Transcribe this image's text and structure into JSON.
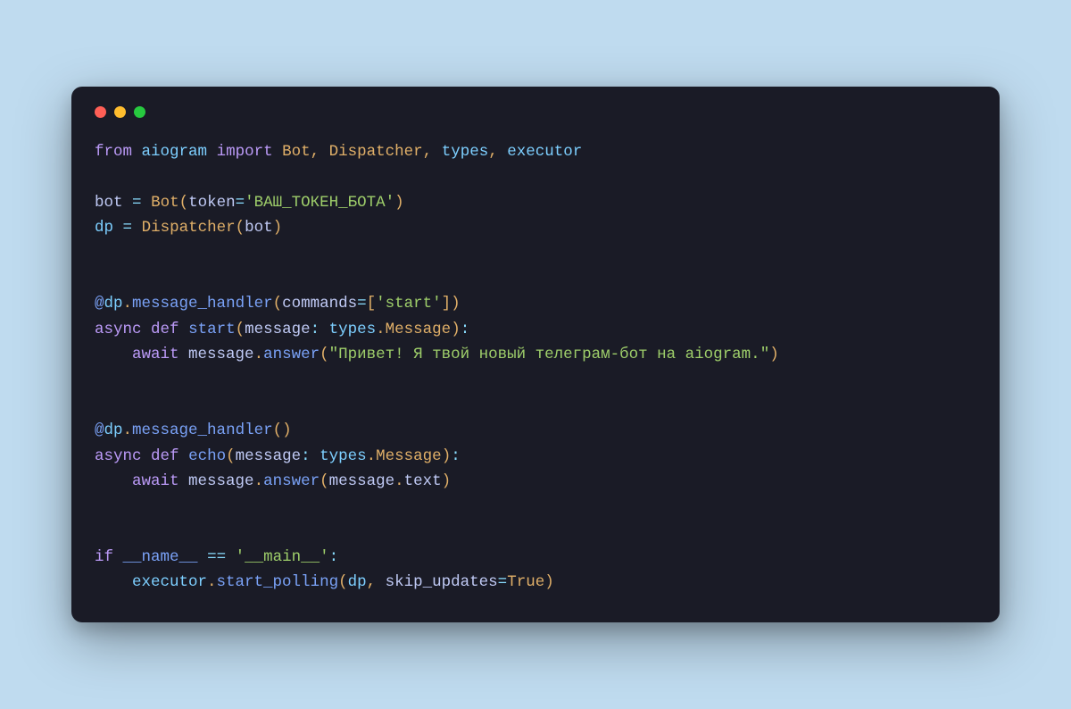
{
  "window": {
    "controls": [
      "close",
      "minimize",
      "zoom"
    ]
  },
  "tokens": [
    [
      [
        "kw",
        "from"
      ],
      [
        "",
        ""
      ],
      [
        "pkg",
        "aiogram"
      ],
      [
        "",
        ""
      ],
      [
        "kw",
        "import"
      ],
      [
        "",
        ""
      ],
      [
        "cls",
        "Bot"
      ],
      [
        "pun",
        ","
      ],
      [
        "",
        ""
      ],
      [
        "cls",
        "Dispatcher"
      ],
      [
        "pun",
        ","
      ],
      [
        "",
        ""
      ],
      [
        "pkg",
        "types"
      ],
      [
        "pun",
        ","
      ],
      [
        "",
        ""
      ],
      [
        "pkg",
        "executor"
      ]
    ],
    [],
    [
      [
        "var",
        "bot"
      ],
      [
        "",
        ""
      ],
      [
        "op",
        "="
      ],
      [
        "",
        ""
      ],
      [
        "cls",
        "Bot"
      ],
      [
        "pun",
        "("
      ],
      [
        "var",
        "token"
      ],
      [
        "op",
        "="
      ],
      [
        "str",
        "'ВАШ_ТОКЕН_БОТА'"
      ],
      [
        "pun",
        ")"
      ]
    ],
    [
      [
        "pkg",
        "dp"
      ],
      [
        "",
        ""
      ],
      [
        "op",
        "="
      ],
      [
        "",
        ""
      ],
      [
        "cls",
        "Dispatcher"
      ],
      [
        "pun",
        "("
      ],
      [
        "var",
        "bot"
      ],
      [
        "pun",
        ")"
      ]
    ],
    [],
    [],
    [
      [
        "at",
        "@"
      ],
      [
        "pkg",
        "dp"
      ],
      [
        "pun",
        "."
      ],
      [
        "fn",
        "message_handler"
      ],
      [
        "pun",
        "("
      ],
      [
        "var",
        "commands"
      ],
      [
        "op",
        "="
      ],
      [
        "pun",
        "["
      ],
      [
        "str",
        "'start'"
      ],
      [
        "pun",
        "]"
      ],
      [
        "pun",
        ")"
      ]
    ],
    [
      [
        "kw",
        "async"
      ],
      [
        "",
        ""
      ],
      [
        "kw",
        "def"
      ],
      [
        "",
        ""
      ],
      [
        "fn",
        "start"
      ],
      [
        "pun",
        "("
      ],
      [
        "var",
        "message"
      ],
      [
        "op",
        ":"
      ],
      [
        "",
        ""
      ],
      [
        "pkg",
        "types"
      ],
      [
        "pun",
        "."
      ],
      [
        "cls",
        "Message"
      ],
      [
        "pun",
        ")"
      ],
      [
        "op",
        ":"
      ]
    ],
    [
      [
        "",
        "    "
      ],
      [
        "kw",
        "await"
      ],
      [
        "",
        ""
      ],
      [
        "var",
        "message"
      ],
      [
        "pun",
        "."
      ],
      [
        "fn",
        "answer"
      ],
      [
        "pun",
        "("
      ],
      [
        "str",
        "\"Привет! Я твой новый телеграм-бот на aiogram.\""
      ],
      [
        "pun",
        ")"
      ]
    ],
    [],
    [],
    [
      [
        "at",
        "@"
      ],
      [
        "pkg",
        "dp"
      ],
      [
        "pun",
        "."
      ],
      [
        "fn",
        "message_handler"
      ],
      [
        "pun",
        "("
      ],
      [
        "pun",
        ")"
      ]
    ],
    [
      [
        "kw",
        "async"
      ],
      [
        "",
        ""
      ],
      [
        "kw",
        "def"
      ],
      [
        "",
        ""
      ],
      [
        "fn",
        "echo"
      ],
      [
        "pun",
        "("
      ],
      [
        "var",
        "message"
      ],
      [
        "op",
        ":"
      ],
      [
        "",
        ""
      ],
      [
        "pkg",
        "types"
      ],
      [
        "pun",
        "."
      ],
      [
        "cls",
        "Message"
      ],
      [
        "pun",
        ")"
      ],
      [
        "op",
        ":"
      ]
    ],
    [
      [
        "",
        "    "
      ],
      [
        "kw",
        "await"
      ],
      [
        "",
        ""
      ],
      [
        "var",
        "message"
      ],
      [
        "pun",
        "."
      ],
      [
        "fn",
        "answer"
      ],
      [
        "pun",
        "("
      ],
      [
        "var",
        "message"
      ],
      [
        "pun",
        "."
      ],
      [
        "var",
        "text"
      ],
      [
        "pun",
        ")"
      ]
    ],
    [],
    [],
    [
      [
        "kw",
        "if"
      ],
      [
        "",
        ""
      ],
      [
        "fn",
        "__name__"
      ],
      [
        "",
        ""
      ],
      [
        "op",
        "=="
      ],
      [
        "",
        ""
      ],
      [
        "str",
        "'__main__'"
      ],
      [
        "op",
        ":"
      ]
    ],
    [
      [
        "",
        "    "
      ],
      [
        "pkg",
        "executor"
      ],
      [
        "pun",
        "."
      ],
      [
        "fn",
        "start_polling"
      ],
      [
        "pun",
        "("
      ],
      [
        "pkg",
        "dp"
      ],
      [
        "pun",
        ","
      ],
      [
        "",
        ""
      ],
      [
        "var",
        "skip_updates"
      ],
      [
        "op",
        "="
      ],
      [
        "cls",
        "True"
      ],
      [
        "pun",
        ")"
      ]
    ]
  ]
}
